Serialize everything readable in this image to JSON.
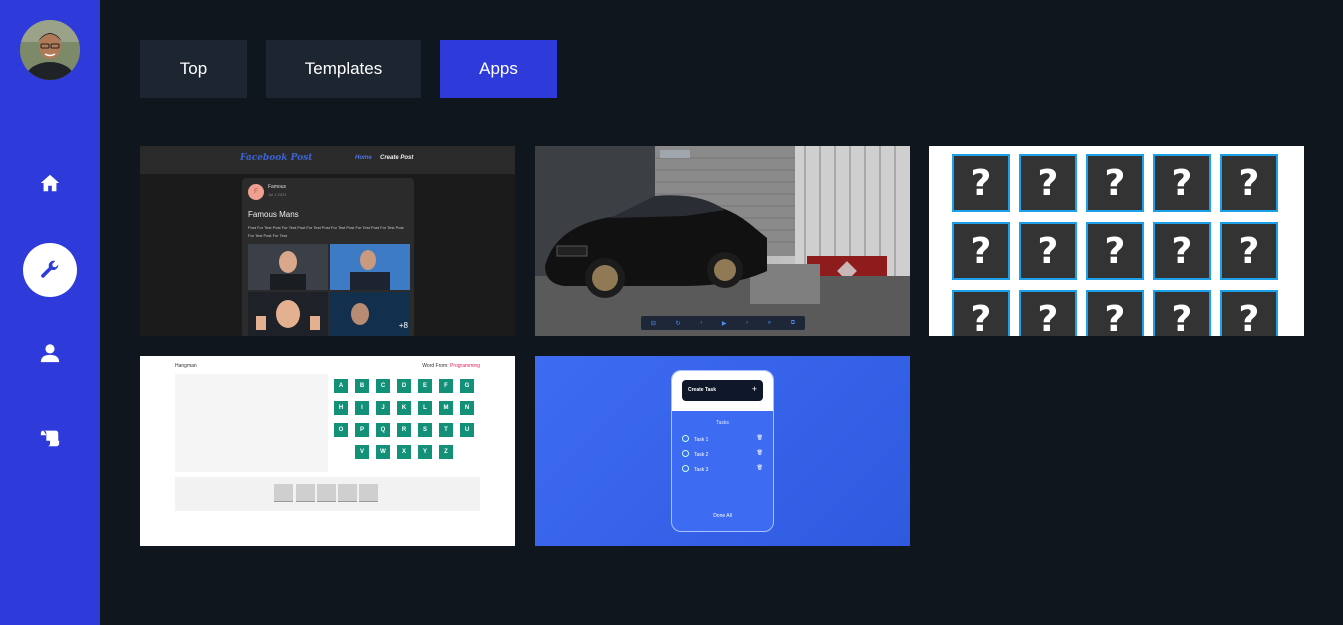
{
  "sidebar": {
    "avatar_alt": "",
    "items": [
      {
        "name": "home",
        "icon": "home-icon"
      },
      {
        "name": "tools",
        "icon": "wrench-icon",
        "active": true
      },
      {
        "name": "profile",
        "icon": "user-icon"
      },
      {
        "name": "scroll",
        "icon": "scroll-icon"
      }
    ]
  },
  "tabs": [
    {
      "label": "Top",
      "active": false
    },
    {
      "label": "Templates",
      "active": false
    },
    {
      "label": "Apps",
      "active": true
    }
  ],
  "colors": {
    "accent": "#2f3adb",
    "background": "#0f161e",
    "tab_bg": "#1c2530"
  },
  "cards": {
    "facebook": {
      "title": "Facebook Post",
      "nav_home": "Home",
      "nav_create": "Create Post",
      "avatar_letter": "F",
      "author": "Famous",
      "date": "Jul 1 2021",
      "heading": "Famous Mans",
      "body": "Post For Test Post For Test Post For Test Post For Test Post For Test Post For Test Post For Test Post For Test",
      "more_count": "+8"
    },
    "car": {
      "controls": [
        "⊟",
        "↻",
        "‹",
        "▶",
        "›",
        "»",
        "⧉"
      ]
    },
    "memory": {
      "tile_symbol": "?"
    },
    "hangman": {
      "title": "Hangman",
      "word_from_label": "Word From:",
      "word_from_value": "Programming",
      "letters_row1": [
        "A",
        "B",
        "C",
        "D",
        "E",
        "F",
        "G"
      ],
      "letters_row2": [
        "H",
        "I",
        "J",
        "K",
        "L",
        "M",
        "N"
      ],
      "letters_row3": [
        "O",
        "P",
        "Q",
        "R",
        "S",
        "T",
        "U"
      ],
      "letters_row4": [
        "V",
        "W",
        "X",
        "Y",
        "Z"
      ]
    },
    "task": {
      "bar_label": "Create Task",
      "bar_plus": "+",
      "header": "Tasks",
      "rows": [
        "Task 1",
        "Task 2",
        "Task 3"
      ],
      "done_label": "Done All"
    }
  }
}
